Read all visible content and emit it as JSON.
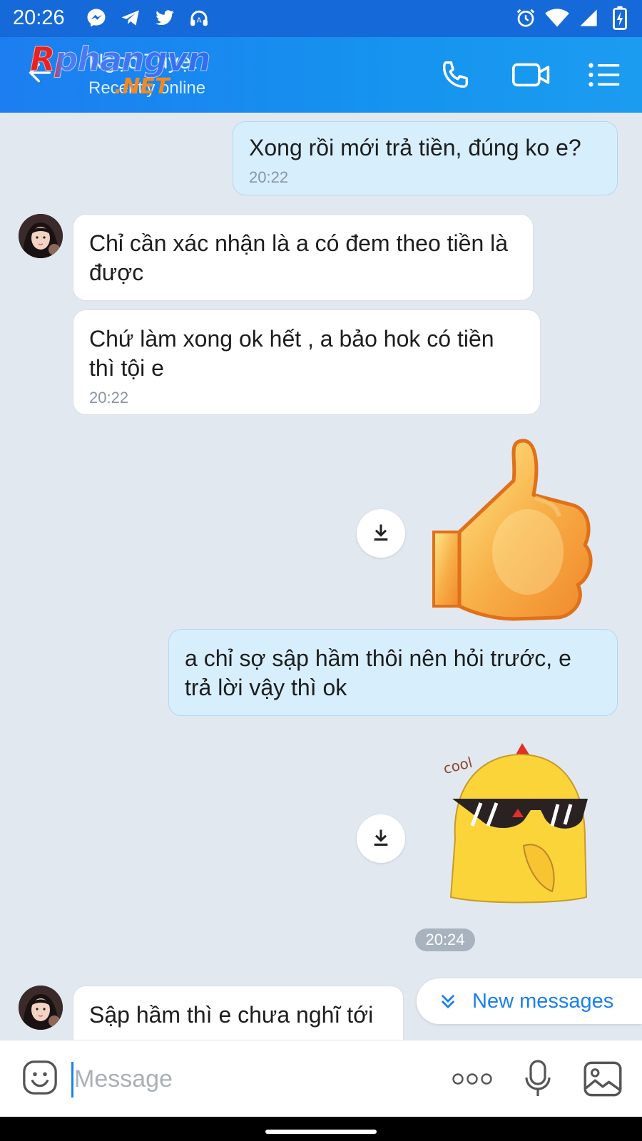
{
  "status_bar": {
    "time": "20:26",
    "left_icons": [
      "messenger-icon",
      "telegram-icon",
      "twitter-icon",
      "headset-icon"
    ],
    "right_icons": [
      "alarm-icon",
      "wifi-icon",
      "signal-icon",
      "battery-charging-icon"
    ]
  },
  "header": {
    "contact_name": "Ngọc Tuyệt",
    "contact_status": "Recently online",
    "watermark": {
      "main": "Rphangvn",
      "suffix": ".NET"
    },
    "actions": [
      "phone-icon",
      "video-call-icon",
      "menu-list-icon"
    ]
  },
  "colors": {
    "header_bg": "#1c7ef0",
    "status_bar_bg": "#1669d8",
    "chat_bg": "#e2e8f0",
    "outgoing_bubble": "#d7eefc",
    "incoming_bubble": "#ffffff",
    "accent": "#1a7ff0"
  },
  "messages": [
    {
      "direction": "out",
      "text": "Xong rồi mới trả tiền, đúng ko e?",
      "time": "20:22"
    },
    {
      "direction": "in",
      "text": "Chỉ cần xác nhận là a có đem theo tiền là được",
      "time": ""
    },
    {
      "direction": "in",
      "text": "Chứ làm xong ok hết , a bảo hok có tiền thì tội e",
      "time": "20:22"
    },
    {
      "direction": "out",
      "type": "sticker",
      "sticker": "thumbs-up-sticker"
    },
    {
      "direction": "out",
      "text": "a chỉ sợ sập hầm thôi nên hỏi trước, e trả lời vậy thì ok",
      "time": ""
    },
    {
      "direction": "out",
      "type": "sticker",
      "sticker": "cool-chick-sticker",
      "sticker_text": "cool"
    },
    {
      "direction": "in",
      "text": "Sập hầm thì e chưa nghĩ tới",
      "time": ""
    }
  ],
  "time_divider": "20:24",
  "new_messages_label": "New messages",
  "input": {
    "placeholder": "Message",
    "value": ""
  },
  "input_actions": [
    "emoji-icon",
    "more-dots-icon",
    "microphone-icon",
    "image-icon"
  ]
}
